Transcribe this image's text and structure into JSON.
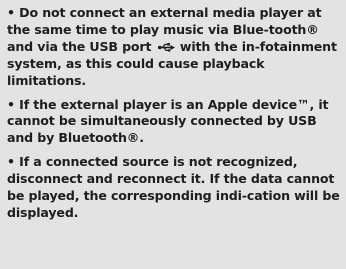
{
  "notes": [
    {
      "bullet": "•",
      "before_icon": "Do not connect an external media player at the same time to play music via Blue-tooth® and via the USB port ",
      "icon": "usb-icon",
      "after_icon": " with the in-fotainment system, as this could cause playback limitations."
    },
    {
      "bullet": "•",
      "text": "If the external player is an Apple device™, it cannot be simultaneously connected by USB and by Bluetooth®."
    },
    {
      "bullet": "•",
      "text": "If a connected source is not recognized, disconnect and reconnect it. If the data cannot be played, the corresponding indi-cation will be displayed."
    }
  ],
  "colors": {
    "background": "#e3e3e3",
    "text": "#1e1e1e"
  }
}
